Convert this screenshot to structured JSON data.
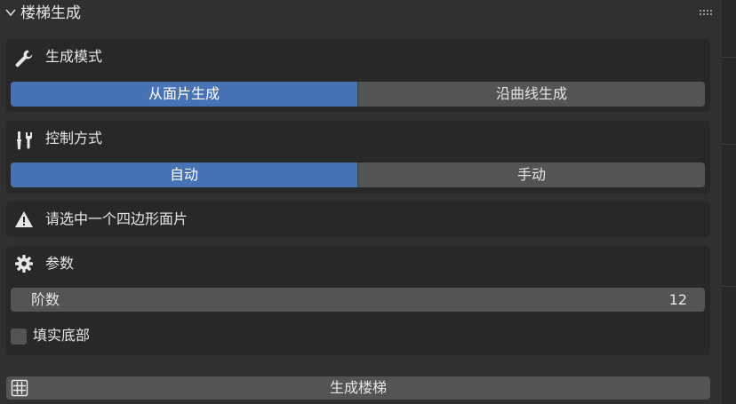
{
  "panel": {
    "title": "楼梯生成"
  },
  "generation_mode": {
    "label": "生成模式",
    "icon": "wrench-icon",
    "options": [
      "从面片生成",
      "沿曲线生成"
    ],
    "selected": "从面片生成"
  },
  "control_mode": {
    "label": "控制方式",
    "icon": "tools-icon",
    "options": [
      "自动",
      "手动"
    ],
    "selected": "自动"
  },
  "warning": {
    "icon": "warning-icon",
    "text": "请选中一个四边形面片"
  },
  "params": {
    "label": "参数",
    "icon": "gear-icon",
    "steps_label": "阶数",
    "steps_value": "12",
    "fill_bottom_label": "填实底部",
    "fill_bottom_checked": false
  },
  "generate_button": {
    "icon": "grid-icon",
    "label": "生成楼梯"
  },
  "colors": {
    "accent": "#4772b3",
    "panel_bg": "#303030",
    "box_bg": "#282828",
    "widget_bg": "#545454"
  }
}
